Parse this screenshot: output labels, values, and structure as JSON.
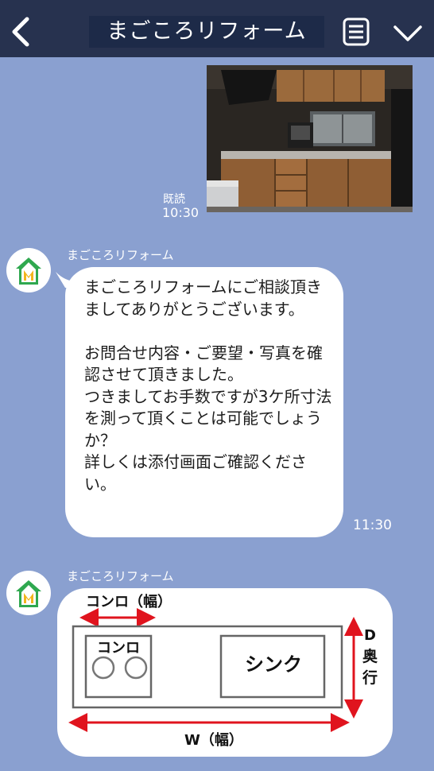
{
  "header": {
    "title": "まごころリフォーム",
    "back_icon": "chevron-left-icon",
    "menu_icon": "notes-icon",
    "expand_icon": "chevron-down-icon",
    "background": "#27324f"
  },
  "messages": {
    "photo": {
      "read_label": "既読",
      "time": "10:30"
    },
    "text_message": {
      "sender": "まごころリフォーム",
      "text": "まごころリフォームにご相談頂きましてありがとうございます。\n\nお問合せ内容・ご要望・写真を確認させて頂きました。\nつきましてお手数ですが3ケ所寸法を測って頂くことは可能でしょうか？\n詳しくは添付画面ご確認ください。",
      "time": "11:30"
    },
    "diagram_message": {
      "sender": "まごころリフォーム",
      "labels": {
        "konro_width": "コンロ（幅）",
        "konro": "コンロ",
        "sink": "シンク",
        "depth_d": "D",
        "depth_label": "奥行",
        "width": "W（幅）"
      }
    }
  },
  "colors": {
    "chat_background": "#8aa0d0",
    "accent_red": "#e0141e",
    "logo_green": "#2fa84f",
    "logo_yellow": "#f2b51d"
  }
}
